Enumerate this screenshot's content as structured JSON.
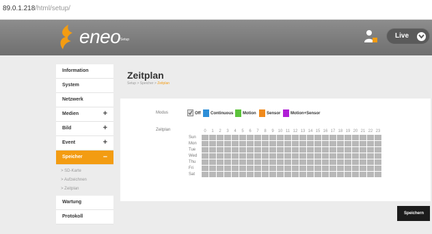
{
  "browser": {
    "url_host": "89.0.1.218",
    "url_path": "/html/setup/"
  },
  "header": {
    "brand": "eneo",
    "sub": "Setup",
    "live_label": "Live"
  },
  "sidebar": {
    "items": [
      {
        "label": "Information",
        "plus": ""
      },
      {
        "label": "System",
        "plus": ""
      },
      {
        "label": "Netzwerk",
        "plus": ""
      },
      {
        "label": "Medien",
        "plus": "+"
      },
      {
        "label": "Bild",
        "plus": "+"
      },
      {
        "label": "Event",
        "plus": "+"
      },
      {
        "label": "Speicher",
        "plus": "–"
      }
    ],
    "subitems": [
      "SD-Karte",
      "Aufzeichnen",
      "Zeitplan"
    ],
    "bottom": [
      "Wartung",
      "Protokoll"
    ]
  },
  "main": {
    "title": "Zeitplan",
    "breadcrumb": {
      "a": "Setup",
      "sep1": " > ",
      "b": "Speicher",
      "sep2": " > ",
      "current": "Zeitplan"
    },
    "modus_label": "Modus",
    "zeitplan_label": "Zeitplan",
    "legend": {
      "off": "Off",
      "continuous": "Continuous",
      "motion": "Motion",
      "sensor": "Sensor",
      "motion_sensor": "Motion+Sensor"
    },
    "colors": {
      "accent": "#f39c12",
      "continuous": "#2e8fd8",
      "motion": "#5cc33b",
      "sensor": "#f08a1c",
      "motion_sensor": "#b01fd6"
    },
    "hours": [
      "0",
      "1",
      "2",
      "3",
      "4",
      "5",
      "6",
      "7",
      "8",
      "9",
      "10",
      "11",
      "12",
      "13",
      "14",
      "15",
      "16",
      "17",
      "18",
      "19",
      "20",
      "21",
      "22",
      "23"
    ],
    "days": [
      "Sun",
      "Mon",
      "Tue",
      "Wed",
      "Thu",
      "Fri",
      "Sat"
    ]
  },
  "save_label": "Speichern"
}
